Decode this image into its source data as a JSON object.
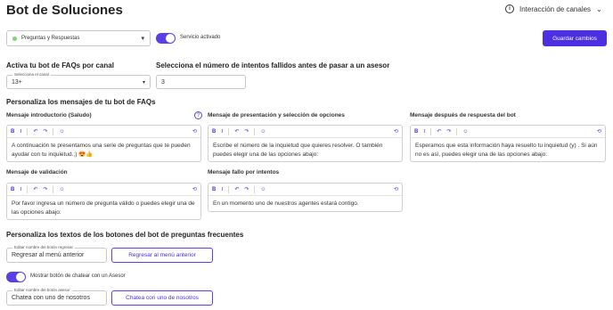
{
  "header": {
    "title": "Bot de Soluciones",
    "channels_label": "Interacción de canales"
  },
  "top": {
    "bot_type": "Preguntas y Respuestas",
    "service_label": "Servicio activado",
    "save_label": "Guardar cambios"
  },
  "activation": {
    "heading": "Activa tu bot de FAQs por canal",
    "channel_floating": "Selecciona el canal",
    "channel_value": "13+",
    "attempts_heading": "Selecciona el número de intentos fallidos antes de pasar a un asesor",
    "attempts_value": "3"
  },
  "messages": {
    "heading": "Personaliza los mensajes de tu bot de FAQs",
    "intro_title": "Mensaje introductorio (Saludo)",
    "intro_text": "A continuación te presentamos una serie de preguntas que te pueden ayudar con tu inquietud.;) 😍👍",
    "presentation_title": "Mensaje de presentación y selección de opciones",
    "presentation_text": "Escribe el número de la inquietud que quieres resolver. O también puedes elegir una de las opciones abajo:",
    "after_title": "Mensaje después de respuesta del bot",
    "after_text": "Esperamos que esta información haya resuelto tu inquietud (y) . Si aún no es así, puedes elegir una de las opciones abajo:",
    "validation_title": "Mensaje de validación",
    "validation_text": "Por favor ingresa un número de pregunta válido o puedes elegir una de las opciones abajo:",
    "fail_title": "Mensaje fallo por intentos",
    "fail_text": "En un momento uno de nuestros agentes estará contigo."
  },
  "buttons": {
    "heading": "Personaliza los textos de los botones del bot de preguntas frecuentes",
    "back_floating": "Editar nombre del botón regresar",
    "back_value": "Regresar al menú anterior",
    "back_preview": "Regresar al menú anterior",
    "chat_toggle_label": "Mostrar botón de chatear con un Asesor",
    "chat_floating": "Editar nombre del botón asesor",
    "chat_value": "Chatea con uno de nosotros",
    "chat_preview": "Chatea con uno de nosotros"
  },
  "toolbar": {
    "bold": "B",
    "italic": "I",
    "strike": "S̶",
    "undo": "↶",
    "redo": "↷",
    "emoji": "☺",
    "reset": "⟲"
  },
  "colors": {
    "accent": "#4b2fe0",
    "toggle": "#5a3ee8",
    "status_dot": "#7bd86d"
  }
}
